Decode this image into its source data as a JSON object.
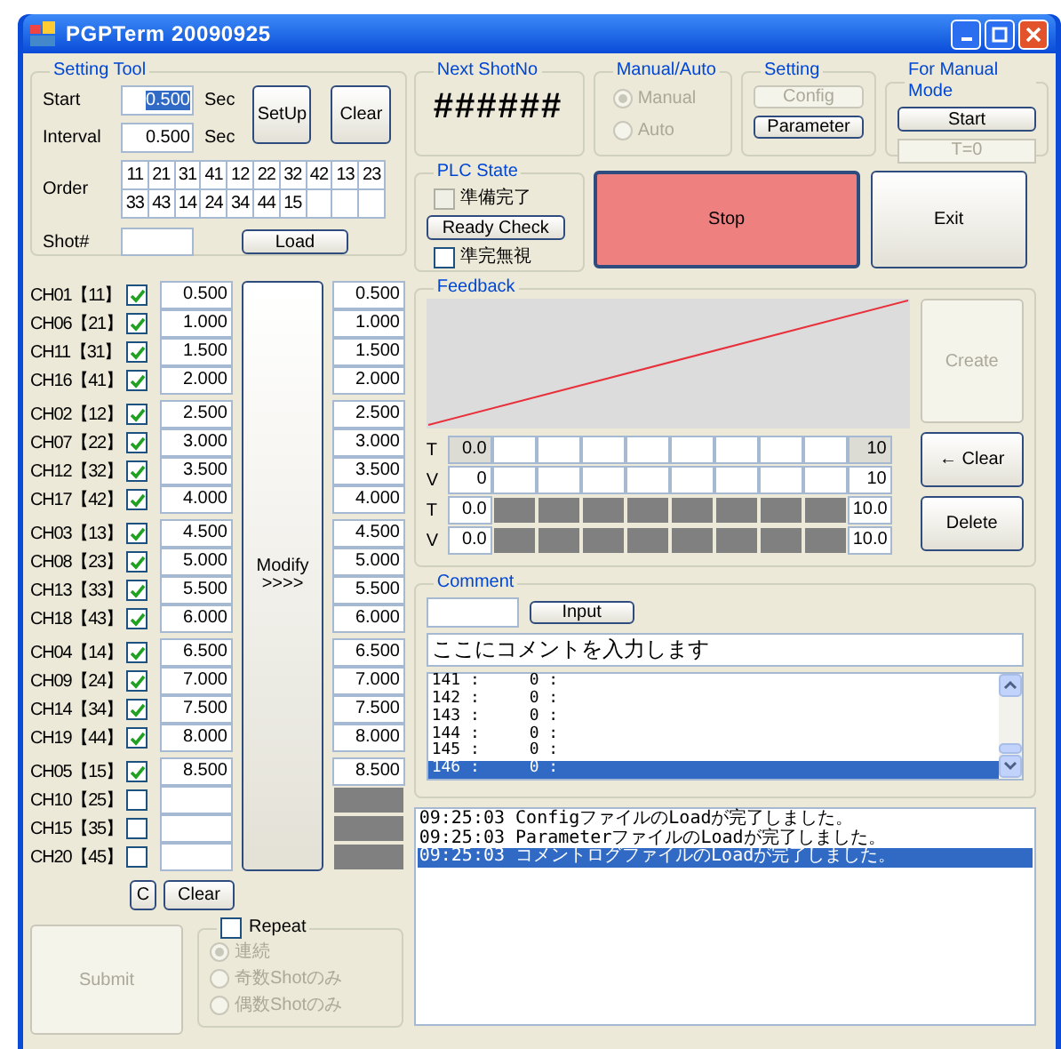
{
  "window": {
    "title": "PGPTerm 20090925"
  },
  "setting_tool": {
    "title": "Setting Tool",
    "start": {
      "label": "Start",
      "value": "0.500",
      "unit": "Sec",
      "focused": true
    },
    "interval": {
      "label": "Interval",
      "value": "0.500",
      "unit": "Sec",
      "focused": false
    },
    "setup_button": "SetUp",
    "clear_button": "Clear",
    "order": {
      "label": "Order",
      "cells": [
        "11",
        "21",
        "31",
        "41",
        "12",
        "22",
        "32",
        "42",
        "13",
        "23",
        "33",
        "43",
        "14",
        "24",
        "34",
        "44",
        "15"
      ]
    },
    "shot": {
      "label": "Shot#"
    },
    "load_button": "Load"
  },
  "channel_groups": [
    {
      "rows": [
        {
          "label": "CH01【11】",
          "checked": true,
          "value": "0.500",
          "result": "0.500"
        },
        {
          "label": "CH06【21】",
          "checked": true,
          "value": "1.000",
          "result": "1.000"
        },
        {
          "label": "CH11【31】",
          "checked": true,
          "value": "1.500",
          "result": "1.500"
        },
        {
          "label": "CH16【41】",
          "checked": true,
          "value": "2.000",
          "result": "2.000"
        }
      ]
    },
    {
      "rows": [
        {
          "label": "CH02【12】",
          "checked": true,
          "value": "2.500",
          "result": "2.500"
        },
        {
          "label": "CH07【22】",
          "checked": true,
          "value": "3.000",
          "result": "3.000"
        },
        {
          "label": "CH12【32】",
          "checked": true,
          "value": "3.500",
          "result": "3.500"
        },
        {
          "label": "CH17【42】",
          "checked": true,
          "value": "4.000",
          "result": "4.000"
        }
      ]
    },
    {
      "rows": [
        {
          "label": "CH03【13】",
          "checked": true,
          "value": "4.500",
          "result": "4.500"
        },
        {
          "label": "CH08【23】",
          "checked": true,
          "value": "5.000",
          "result": "5.000"
        },
        {
          "label": "CH13【33】",
          "checked": true,
          "value": "5.500",
          "result": "5.500"
        },
        {
          "label": "CH18【43】",
          "checked": true,
          "value": "6.000",
          "result": "6.000"
        }
      ]
    },
    {
      "rows": [
        {
          "label": "CH04【14】",
          "checked": true,
          "value": "6.500",
          "result": "6.500"
        },
        {
          "label": "CH09【24】",
          "checked": true,
          "value": "7.000",
          "result": "7.000"
        },
        {
          "label": "CH14【34】",
          "checked": true,
          "value": "7.500",
          "result": "7.500"
        },
        {
          "label": "CH19【44】",
          "checked": true,
          "value": "8.000",
          "result": "8.000"
        }
      ]
    },
    {
      "rows": [
        {
          "label": "CH05【15】",
          "checked": true,
          "value": "8.500",
          "result": "8.500"
        },
        {
          "label": "CH10【25】",
          "checked": false
        },
        {
          "label": "CH15【35】",
          "checked": false
        },
        {
          "label": "CH20【45】",
          "checked": false
        }
      ]
    }
  ],
  "modify_button": [
    "Modify",
    ">>>>"
  ],
  "c_button": "C",
  "clear_button": "Clear",
  "submit_button": {
    "label": "Submit",
    "disabled": true
  },
  "repeat": {
    "label": "Repeat",
    "checked": false,
    "disabled": true,
    "options": [
      {
        "label": "連続",
        "selected": true
      },
      {
        "label": "奇数Shotのみ",
        "selected": false
      },
      {
        "label": "偶数Shotのみ",
        "selected": false
      }
    ]
  },
  "next_shot": {
    "title": "Next ShotNo",
    "value": "######"
  },
  "mode": {
    "title": "Manual/Auto",
    "disabled": true,
    "options": [
      {
        "label": "Manual",
        "selected": true
      },
      {
        "label": "Auto",
        "selected": false
      }
    ]
  },
  "setting": {
    "title": "Setting",
    "buttons": [
      {
        "label": "Config",
        "disabled": true
      },
      {
        "label": "Parameter",
        "disabled": false
      }
    ]
  },
  "manual_mode": {
    "title": "For Manual Mode",
    "start_button": "Start",
    "timer": "T=0"
  },
  "plc_state": {
    "title": "PLC State",
    "ready": {
      "label": "準備完了",
      "checked": false,
      "disabled": true
    },
    "ready_check_button": "Ready Check",
    "ignore": {
      "label": "準完無視",
      "checked": false,
      "disabled": false
    }
  },
  "stop_button": "Stop",
  "exit_button": "Exit",
  "feedback": {
    "title": "Feedback",
    "create_button": {
      "label": "Create",
      "disabled": true
    },
    "clear_button": "← Clear",
    "delete_button": "Delete",
    "rows": [
      {
        "label": "T",
        "kind": "editable",
        "first": "0.0",
        "last": "10",
        "first_readonly": true,
        "last_readonly": true
      },
      {
        "label": "V",
        "kind": "editable",
        "first": "0",
        "last": "10",
        "first_readonly": false,
        "last_readonly": false
      },
      {
        "label": "T",
        "kind": "locked",
        "first": "0.0",
        "last": "10.0",
        "first_readonly": false,
        "last_readonly": false
      },
      {
        "label": "V",
        "kind": "locked",
        "first": "0.0",
        "last": "10.0",
        "first_readonly": false,
        "last_readonly": false
      }
    ]
  },
  "comment": {
    "title": "Comment",
    "input_button": "Input",
    "text": "ここにコメントを入力します",
    "list": [
      {
        "number": "141 :",
        "value": "0 :",
        "selected": false
      },
      {
        "number": "142 :",
        "value": "0 :",
        "selected": false
      },
      {
        "number": "143 :",
        "value": "0 :",
        "selected": false
      },
      {
        "number": "144 :",
        "value": "0 :",
        "selected": false
      },
      {
        "number": "145 :",
        "value": "0 :",
        "selected": false
      },
      {
        "number": "146 :",
        "value": "0 :",
        "selected": true
      }
    ]
  },
  "log": [
    {
      "text": "09:25:03 ConfigファイルのLoadが完了しました。",
      "selected": false
    },
    {
      "text": "09:25:03 ParameterファイルのLoadが完了しました。",
      "selected": false
    },
    {
      "text": "09:25:03 コメントログファイルのLoadが完了しました。",
      "selected": true
    }
  ]
}
